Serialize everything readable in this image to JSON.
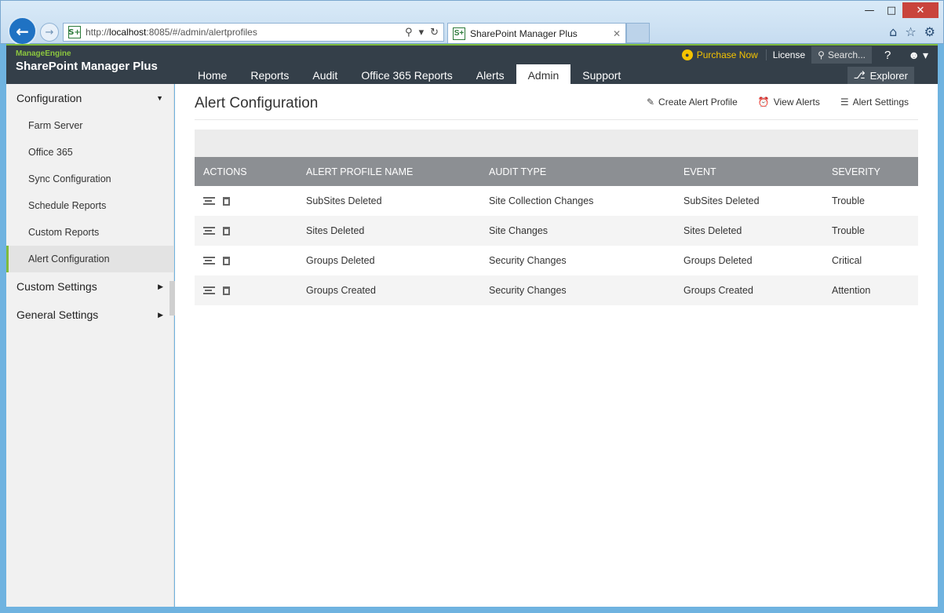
{
  "browser": {
    "url_prefix": "http://",
    "url_host": "localhost",
    "url_rest": ":8085/#/admin/alertprofiles",
    "tab_title": "SharePoint Manager Plus",
    "tab_icon": "S+"
  },
  "header": {
    "brand_small": "ManageEngine",
    "brand_main": "SharePoint Manager Plus",
    "purchase": "Purchase Now",
    "license": "License",
    "search_placeholder": "Search...",
    "help": "?",
    "explorer": "Explorer"
  },
  "nav": {
    "items": [
      "Home",
      "Reports",
      "Audit",
      "Office 365 Reports",
      "Alerts",
      "Admin",
      "Support"
    ],
    "active": "Admin"
  },
  "sidebar": {
    "configuration": "Configuration",
    "items": [
      "Farm Server",
      "Office 365",
      "Sync Configuration",
      "Schedule Reports",
      "Custom Reports",
      "Alert Configuration"
    ],
    "active": "Alert Configuration",
    "custom_settings": "Custom Settings",
    "general_settings": "General Settings"
  },
  "main": {
    "title": "Alert Configuration",
    "actions": {
      "create": "Create Alert Profile",
      "view": "View Alerts",
      "settings": "Alert Settings"
    },
    "table": {
      "headers": [
        "ACTIONS",
        "ALERT PROFILE NAME",
        "AUDIT TYPE",
        "EVENT",
        "SEVERITY"
      ],
      "rows": [
        {
          "name": "SubSites Deleted",
          "audit_type": "Site Collection Changes",
          "event": "SubSites Deleted",
          "severity": "Trouble"
        },
        {
          "name": "Sites Deleted",
          "audit_type": "Site Changes",
          "event": "Sites Deleted",
          "severity": "Trouble"
        },
        {
          "name": "Groups Deleted",
          "audit_type": "Security Changes",
          "event": "Groups Deleted",
          "severity": "Critical"
        },
        {
          "name": "Groups Created",
          "audit_type": "Security Changes",
          "event": "Groups Created",
          "severity": "Attention"
        }
      ]
    }
  },
  "colors": {
    "header_bg": "#343f49",
    "brand_green": "#7fbb3c",
    "purchase_gold": "#f5c300",
    "table_header": "#8c8f93"
  }
}
